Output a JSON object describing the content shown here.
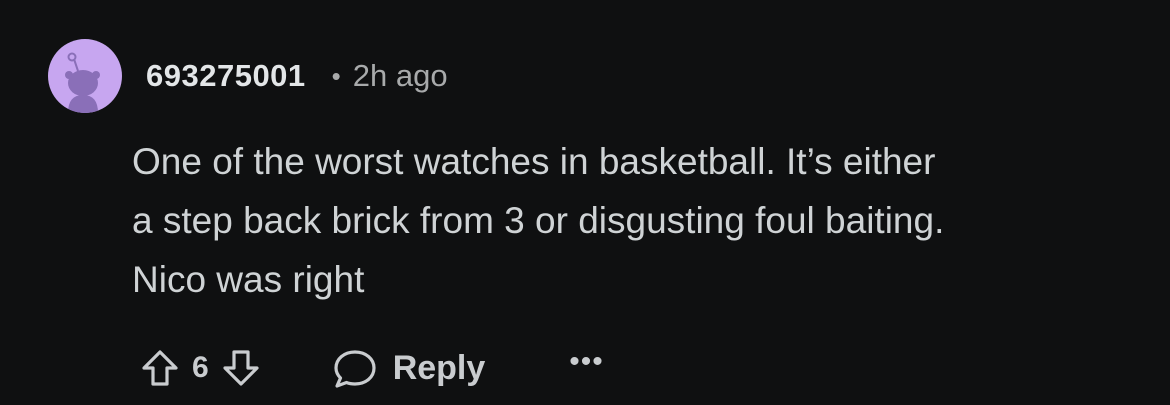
{
  "comment": {
    "username": "693275001",
    "separator": "•",
    "timestamp": "2h ago",
    "body_lines": [
      "One of the worst watches in basketball. It’s either",
      "a step back brick from 3 or disgusting foul baiting.",
      "Nico was right"
    ],
    "score": "6",
    "reply_label": "Reply",
    "more_label": "•••",
    "avatar_color": "#c7a6f0",
    "icons": {
      "upvote": "upvote-arrow-icon",
      "downvote": "downvote-arrow-icon",
      "reply": "speech-bubble-icon",
      "more": "ellipsis-icon"
    }
  }
}
